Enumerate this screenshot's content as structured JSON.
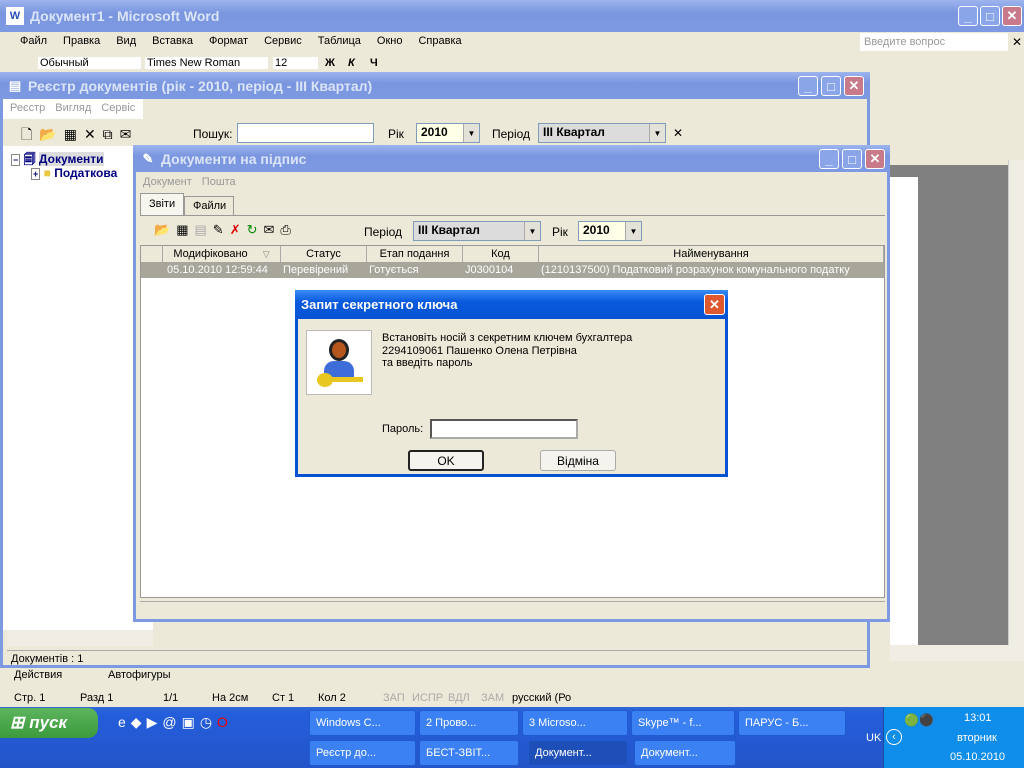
{
  "word": {
    "title": "Документ1 - Microsoft Word",
    "menu": [
      "Файл",
      "Правка",
      "Вид",
      "Вставка",
      "Формат",
      "Сервис",
      "Таблица",
      "Окно",
      "Справка"
    ],
    "help_placeholder": "Введите вопрос",
    "style": "Обычный",
    "font": "Times New Roman",
    "size": "12",
    "bold": "Ж",
    "italic": "К",
    "underline": "Ч",
    "draw_actions": "Действия",
    "autoshapes": "Автофигуры",
    "status": [
      "Стр. 1",
      "Разд 1",
      "1/1",
      "На 2см",
      "Ст 1",
      "Кол 2",
      "ЗАП",
      "ИСПР",
      "ВДЛ",
      "ЗАМ",
      "русский (Ро"
    ]
  },
  "registry": {
    "title": "Реєстр документів (рік - 2010, період - III Квартал)",
    "menu": [
      "Реєстр",
      "Вигляд",
      "Сервіс"
    ],
    "search_label": "Пошук:",
    "search_value": "",
    "year_label": "Рік",
    "year": "2010",
    "period_label": "Період",
    "period": "III Квартал",
    "tree": [
      {
        "label": "Документи",
        "expander": "−"
      },
      {
        "label": "Податкова",
        "expander": "+"
      }
    ],
    "status": "Документів : 1"
  },
  "docs": {
    "title": "Документи на підпис",
    "menu": [
      "Документ",
      "Пошта"
    ],
    "tabs": [
      "Звіти",
      "Файли"
    ],
    "period_label": "Період",
    "period": "III Квартал",
    "year_label": "Рік",
    "year": "2010",
    "columns": [
      "Модифіковано",
      "Статус",
      "Етап подання",
      "Код",
      "Найменування"
    ],
    "rows": [
      [
        "05.10.2010 12:59:44",
        "Перевірений",
        "Готується",
        "J0300104",
        "(1210137500)  Податковий розрахунок комунального податку"
      ]
    ]
  },
  "dialog": {
    "title": "Запит секретного ключа",
    "message": [
      "Встановіть носій з секретним ключем бухгалтера",
      "2294109061 Пашенко Олена Петрівна",
      "та введіть пароль"
    ],
    "password_label": "Пароль:",
    "password_value": "",
    "ok": "OK",
    "cancel": "Відміна"
  },
  "taskbar": {
    "start": "пуск",
    "row1": [
      "Windows C...",
      "2 Прово...",
      "3 Microso...",
      "Skype™ - f...",
      "ПАРУС - Б..."
    ],
    "row2": [
      "Реєстр до...",
      "БЕСТ-ЗВІТ...",
      "Документ...",
      "Документ..."
    ],
    "lang": "UK",
    "time": "13:01",
    "day": "вторник",
    "date": "05.10.2010"
  }
}
